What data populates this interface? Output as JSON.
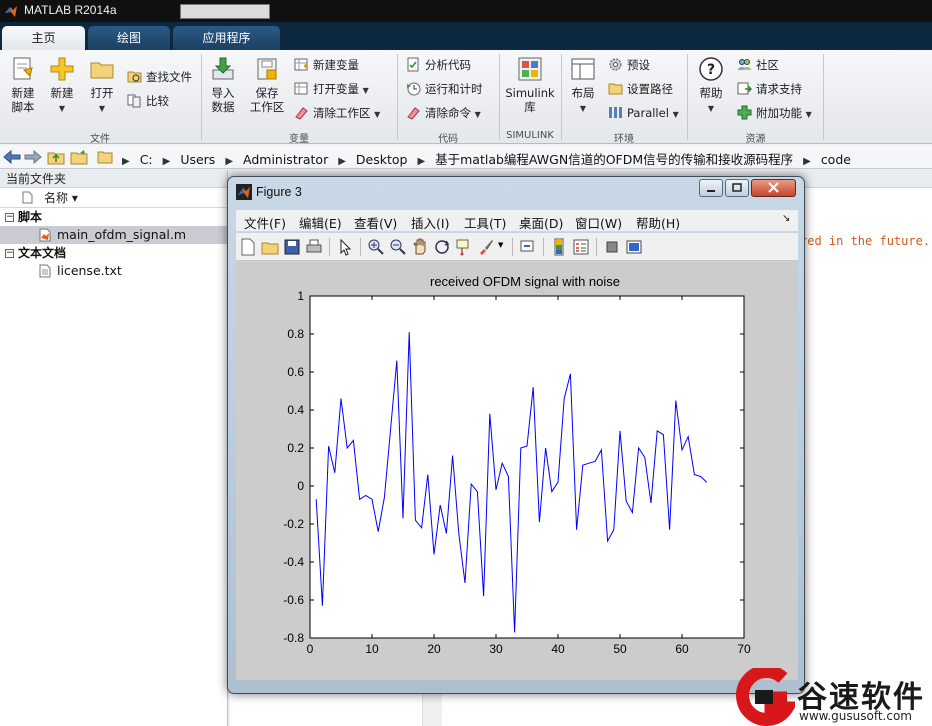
{
  "window": {
    "title": "MATLAB R2014a"
  },
  "tabs": [
    {
      "label": "主页",
      "active": true
    },
    {
      "label": "绘图",
      "active": false
    },
    {
      "label": "应用程序",
      "active": false
    }
  ],
  "ribbon": {
    "new_script": "新建\n脚本",
    "new": "新建",
    "open": "打开",
    "find_files": "查找文件",
    "compare": "比较",
    "group_file": "文件",
    "import_data": "导入\n数据",
    "save_workspace": "保存\n工作区",
    "new_variable": "新建变量",
    "open_variable": "打开变量",
    "clear_workspace": "清除工作区",
    "group_variable": "变量",
    "analyze_code": "分析代码",
    "run_and_time": "运行和计时",
    "clear_commands": "清除命令",
    "group_code": "代码",
    "simulink_library": "Simulink\n库",
    "group_simulink": "SIMULINK",
    "layout": "布局",
    "preferences": "预设",
    "set_path": "设置路径",
    "parallel": "Parallel",
    "group_environment": "环境",
    "help": "帮助",
    "community": "社区",
    "request_support": "请求支持",
    "add_ons": "附加功能",
    "group_resources": "资源"
  },
  "address": {
    "crumbs": [
      "C:",
      "Users",
      "Administrator",
      "Desktop",
      "基于matlab编程AWGN信道的OFDM信号的传输和接收源码程序",
      "code"
    ]
  },
  "folder_panel": {
    "title": "当前文件夹",
    "column_name": "名称 ▾",
    "groups": [
      {
        "label": "脚本",
        "files": [
          {
            "name": "main_ofdm_signal.m",
            "selected": true
          }
        ]
      },
      {
        "label": "文本文档",
        "files": [
          {
            "name": "license.txt",
            "selected": false
          }
        ]
      }
    ]
  },
  "command_window": {
    "partial_line": "red in the future."
  },
  "figure": {
    "title": "Figure 3",
    "menus": [
      "文件(F)",
      "编辑(E)",
      "查看(V)",
      "插入(I)",
      "工具(T)",
      "桌面(D)",
      "窗口(W)",
      "帮助(H)"
    ]
  },
  "chart_data": {
    "type": "line",
    "title": "received OFDM signal with noise",
    "xlabel": "",
    "ylabel": "",
    "xlim": [
      0,
      70
    ],
    "ylim": [
      -0.8,
      1
    ],
    "xticks": [
      0,
      10,
      20,
      30,
      40,
      50,
      60,
      70
    ],
    "yticks": [
      -0.8,
      -0.6,
      -0.4,
      -0.2,
      0,
      0.2,
      0.4,
      0.6,
      0.8,
      1
    ],
    "grid": false,
    "color": "#0000ff",
    "x": [
      1,
      2,
      3,
      4,
      5,
      6,
      7,
      8,
      9,
      10,
      11,
      12,
      13,
      14,
      15,
      16,
      17,
      18,
      19,
      20,
      21,
      22,
      23,
      24,
      25,
      26,
      27,
      28,
      29,
      30,
      31,
      32,
      33,
      34,
      35,
      36,
      37,
      38,
      39,
      40,
      41,
      42,
      43,
      44,
      45,
      46,
      47,
      48,
      49,
      50,
      51,
      52,
      53,
      54,
      55,
      56,
      57,
      58,
      59,
      60,
      61,
      62,
      63,
      64
    ],
    "y": [
      -0.07,
      -0.63,
      0.21,
      0.07,
      0.46,
      0.2,
      0.24,
      -0.07,
      -0.05,
      -0.07,
      -0.24,
      -0.06,
      0.3,
      0.66,
      -0.17,
      0.81,
      -0.18,
      -0.22,
      0.06,
      -0.36,
      -0.1,
      -0.25,
      0.16,
      -0.25,
      -0.51,
      0.01,
      -0.03,
      -0.58,
      0.38,
      -0.02,
      0.12,
      0.05,
      -0.77,
      0.2,
      0.21,
      0.52,
      -0.19,
      0.2,
      -0.03,
      0.02,
      0.46,
      0.59,
      -0.23,
      0.11,
      0.12,
      0.13,
      0.19,
      -0.29,
      -0.23,
      0.29,
      -0.08,
      -0.14,
      0.2,
      0.15,
      -0.09,
      0.29,
      0.27,
      -0.23,
      0.45,
      0.19,
      0.26,
      0.06,
      0.05,
      0.02
    ]
  },
  "watermark": {
    "name": "谷速软件",
    "url": "www.gususoft.com"
  },
  "colors": {
    "ribbon_tab_bar": "#0d2940",
    "line": "#0000ff",
    "cmd_text": "#cf5a19"
  }
}
